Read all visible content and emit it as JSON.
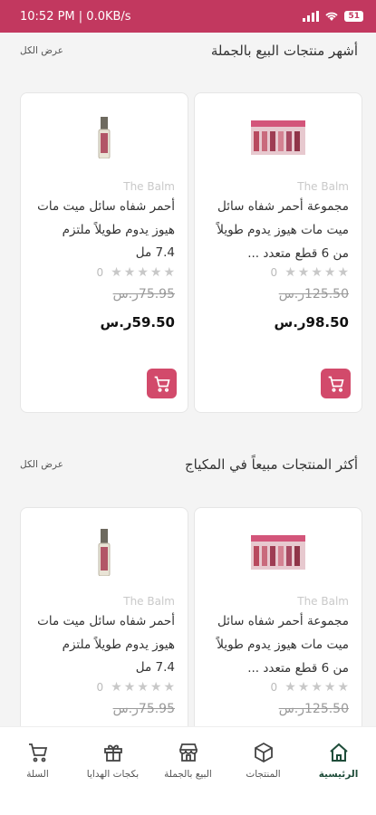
{
  "status": {
    "time": "10:52 PM | 0.0KB/s",
    "battery": "51"
  },
  "sections": [
    {
      "title": "أشهر منتجات البيع بالجملة",
      "view_all": "عرض الكل",
      "products": [
        {
          "brand": "The Balm",
          "name": "مجموعة أحمر شفاه سائل ميت مات هيوز يدوم طويلاً من 6 قطع متعدد ...",
          "size": "",
          "rating_count": "0",
          "old_price": "125.50ر.س",
          "price": "98.50ر.س",
          "image": "lipstick-set"
        },
        {
          "brand": "The Balm",
          "name": "أحمر شفاه سائل ميت مات هيوز يدوم طويلاً ملتزم",
          "size": "7.4 مل",
          "rating_count": "0",
          "old_price": "75.95ر.س",
          "price": "59.50ر.س",
          "image": "lipstick-single"
        }
      ]
    },
    {
      "title": "أكثر المنتجات مبيعاً في المكياج",
      "view_all": "عرض الكل",
      "products": [
        {
          "brand": "The Balm",
          "name": "مجموعة أحمر شفاه سائل ميت مات هيوز يدوم طويلاً من 6 قطع متعدد ...",
          "size": "",
          "rating_count": "0",
          "old_price": "125.50ر.س",
          "price": "",
          "image": "lipstick-set"
        },
        {
          "brand": "The Balm",
          "name": "أحمر شفاه سائل ميت مات هيوز يدوم طويلاً ملتزم",
          "size": "7.4 مل",
          "rating_count": "0",
          "old_price": "75.95ر.س",
          "price": "",
          "image": "lipstick-single"
        }
      ]
    }
  ],
  "bottom_nav": [
    {
      "label": "الرئيسية",
      "icon": "home-icon",
      "active": true
    },
    {
      "label": "المنتجات",
      "icon": "box-icon",
      "active": false
    },
    {
      "label": "البيع بالجملة",
      "icon": "store-icon",
      "active": false
    },
    {
      "label": "بكجات الهدايا",
      "icon": "gift-icon",
      "active": false
    },
    {
      "label": "السلة",
      "icon": "cart-icon",
      "active": false
    }
  ],
  "colors": {
    "brand": "#c2385f",
    "cart_button": "#d24a6b",
    "active_nav": "#1f4d3a"
  }
}
